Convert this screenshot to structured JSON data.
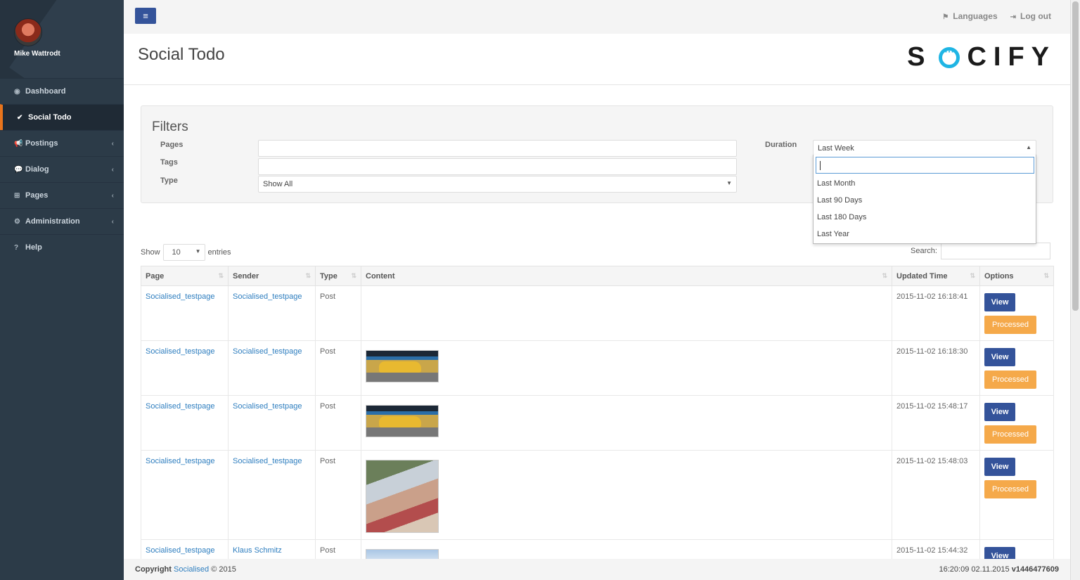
{
  "user": {
    "name": "Mike Wattrodt"
  },
  "sidebar": {
    "items": [
      {
        "label": "Dashboard",
        "icon": "dashboard-icon",
        "glyph": "◉",
        "active": false,
        "chevron": false
      },
      {
        "label": "Social Todo",
        "icon": "check-icon",
        "glyph": "✔",
        "active": true,
        "chevron": false
      },
      {
        "label": "Postings",
        "icon": "bullhorn-icon",
        "glyph": "📢",
        "active": false,
        "chevron": true
      },
      {
        "label": "Dialog",
        "icon": "comments-icon",
        "glyph": "💬",
        "active": false,
        "chevron": true
      },
      {
        "label": "Pages",
        "icon": "sitemap-icon",
        "glyph": "⊞",
        "active": false,
        "chevron": true
      },
      {
        "label": "Administration",
        "icon": "cogs-icon",
        "glyph": "⚙",
        "active": false,
        "chevron": true
      },
      {
        "label": "Help",
        "icon": "question-icon",
        "glyph": "?",
        "active": false,
        "chevron": false
      }
    ]
  },
  "topbar": {
    "languages": "Languages",
    "logout": "Log out"
  },
  "header": {
    "title": "Social Todo",
    "logo_left": "S",
    "logo_right": "CIFY"
  },
  "filters": {
    "title": "Filters",
    "pages_label": "Pages",
    "tags_label": "Tags",
    "type_label": "Type",
    "type_value": "Show All",
    "duration_label": "Duration",
    "duration_value": "Last Week",
    "duration_options": [
      "Last Month",
      "Last 90 Days",
      "Last 180 Days",
      "Last Year"
    ]
  },
  "table_controls": {
    "show": "Show",
    "entries_value": "10",
    "entries": "entries",
    "search": "Search:"
  },
  "table": {
    "headers": [
      "Page",
      "Sender",
      "Type",
      "Content",
      "Updated Time",
      "Options"
    ],
    "rows": [
      {
        "page": "Socialised_testpage",
        "sender": "Socialised_testpage",
        "type": "Post",
        "content": "none",
        "time": "2015-11-02 16:18:41"
      },
      {
        "page": "Socialised_testpage",
        "sender": "Socialised_testpage",
        "type": "Post",
        "content": "car",
        "time": "2015-11-02 16:18:30"
      },
      {
        "page": "Socialised_testpage",
        "sender": "Socialised_testpage",
        "type": "Post",
        "content": "car",
        "time": "2015-11-02 15:48:17"
      },
      {
        "page": "Socialised_testpage",
        "sender": "Socialised_testpage",
        "type": "Post",
        "content": "people",
        "time": "2015-11-02 15:48:03"
      },
      {
        "page": "Socialised_testpage",
        "sender": "Klaus Schmitz",
        "type": "Post",
        "content": "sky",
        "time": "2015-11-02 15:44:32"
      }
    ],
    "view_label": "View",
    "processed_label": "Processed"
  },
  "footer": {
    "copyright": "Copyright",
    "link": "Socialised",
    "year": "© 2015",
    "datetime": "16:20:09 02.11.2015",
    "version": "v1446477609"
  }
}
